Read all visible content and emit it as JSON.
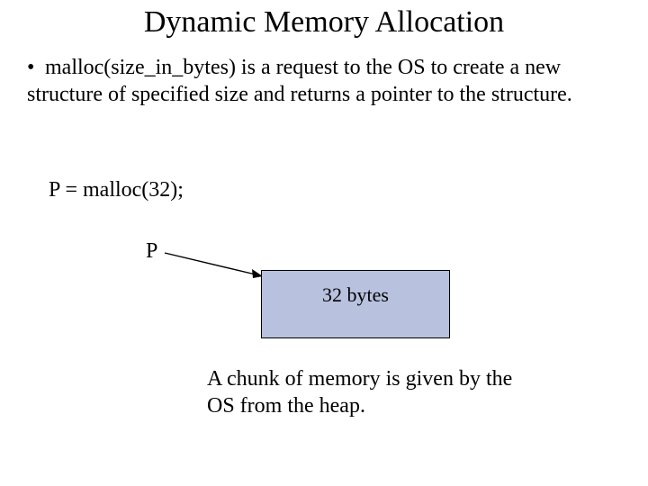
{
  "title": "Dynamic Memory Allocation",
  "bullet": {
    "marker": "•",
    "text": "malloc(size_in_bytes) is a request to the OS to create a new structure of specified size and returns a pointer to the structure."
  },
  "statement": "P = malloc(32);",
  "pointer_label": "P",
  "box_label": "32 bytes",
  "caption": "A chunk of memory is given by the OS from the heap.",
  "colors": {
    "box_fill": "#b8c1de",
    "box_border": "#000000"
  }
}
